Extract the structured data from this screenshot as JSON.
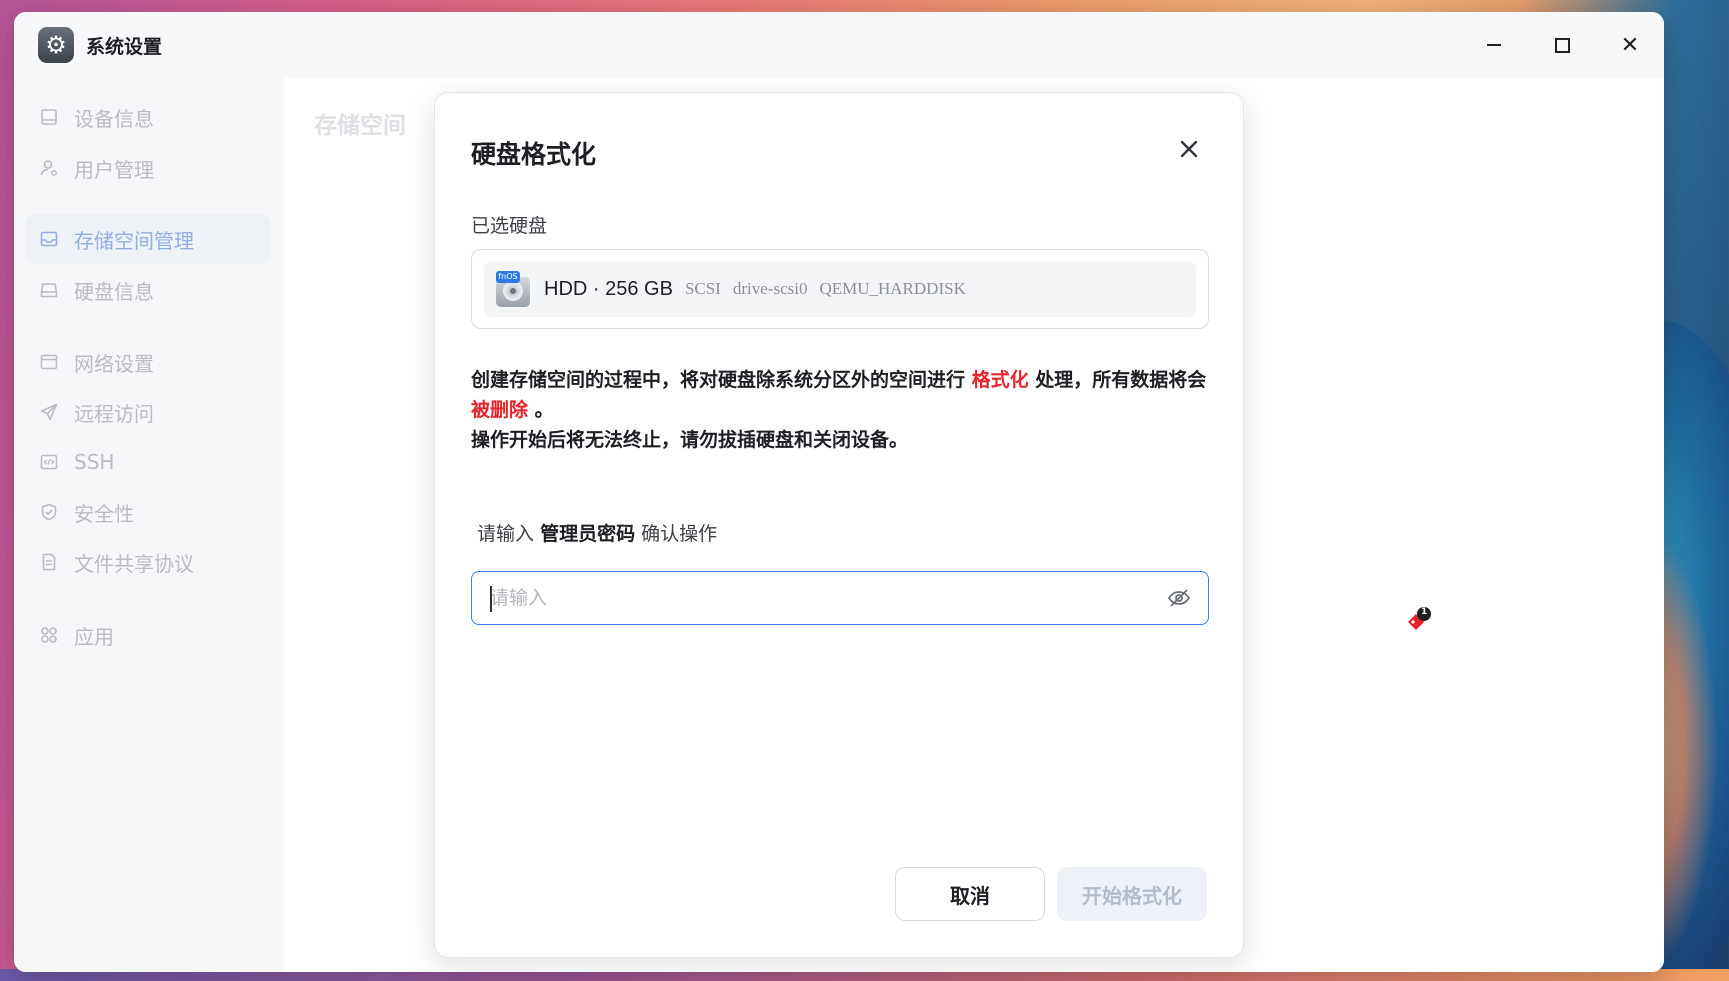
{
  "window": {
    "title": "系统设置",
    "app_icon": "gear-icon"
  },
  "sidebar": {
    "items": [
      {
        "label": "设备信息",
        "icon": "device-icon",
        "active": false
      },
      {
        "label": "用户管理",
        "icon": "user-icon",
        "active": false
      },
      {
        "label": "存储空间管理",
        "icon": "storage-icon",
        "active": true
      },
      {
        "label": "硬盘信息",
        "icon": "disk-icon",
        "active": false
      },
      {
        "label": "网络设置",
        "icon": "network-icon",
        "active": false
      },
      {
        "label": "远程访问",
        "icon": "send-icon",
        "active": false
      },
      {
        "label": "SSH",
        "icon": "code-icon",
        "active": false
      },
      {
        "label": "安全性",
        "icon": "shield-icon",
        "active": false
      },
      {
        "label": "文件共享协议",
        "icon": "document-icon",
        "active": false
      },
      {
        "label": "应用",
        "icon": "apps-icon",
        "active": false
      }
    ]
  },
  "content": {
    "title": "存储空间"
  },
  "modal": {
    "title": "硬盘格式化",
    "selected_label": "已选硬盘",
    "disk": {
      "badge": "fnOS",
      "name": "HDD · 256 GB",
      "bus": "SCSI",
      "id": "drive-scsi0",
      "model": "QEMU_HARDDISK"
    },
    "warning": {
      "part1": "创建存储空间的过程中，将对硬盘除系统分区外的空间进行",
      "highlight1": "格式化",
      "part2": "处理，所有数据将会",
      "highlight2": "被删除",
      "part3": "。",
      "line2": "操作开始后将无法终止，请勿拔插硬盘和关闭设备。"
    },
    "prompt": {
      "prefix": "请输入",
      "bold": "管理员密码",
      "suffix": "确认操作"
    },
    "password": {
      "value": "",
      "placeholder": "请输入"
    },
    "buttons": {
      "cancel": "取消",
      "start": "开始格式化"
    }
  },
  "cursor_badge": {
    "count": "1"
  },
  "colors": {
    "accent": "#3b7ef2",
    "danger": "#e8232b",
    "active_nav": "#8faee6"
  }
}
